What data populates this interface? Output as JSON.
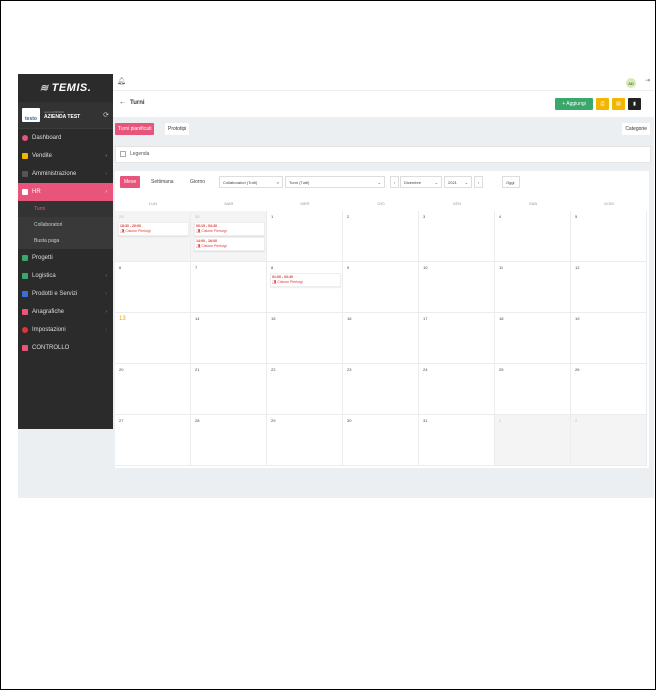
{
  "app": {
    "logo": "TEMIS.",
    "company_small": "testo AZIENDA",
    "company_name": "AZIENDA TEST",
    "company_logo": "testo"
  },
  "sidebar": {
    "items": [
      {
        "label": "Dashboard",
        "color": "#e8547a"
      },
      {
        "label": "Vendite",
        "color": "#f2b600"
      },
      {
        "label": "Amministrazione",
        "color": "#555555"
      },
      {
        "label": "HR",
        "color": "#e8547a"
      },
      {
        "label": "Progetti",
        "color": "#3aa76d"
      },
      {
        "label": "Logistica",
        "color": "#3aa76d"
      },
      {
        "label": "Prodotti e Servizi",
        "color": "#3b6fd8"
      },
      {
        "label": "Anagrafiche",
        "color": "#e8547a"
      },
      {
        "label": "Impostazioni",
        "color": "#e03535"
      },
      {
        "label": "CONTROLLO",
        "color": "#e8547a"
      }
    ],
    "hr_sub": [
      "Turni",
      "Collaboratori",
      "Busta paga"
    ]
  },
  "topbar": {
    "avatar": "AD"
  },
  "header": {
    "back": "←",
    "title": "Turni",
    "add_label": "+ Aggiungi",
    "add_color": "#3aa76d",
    "icon_btn_color": "#f2b600",
    "delete_color": "#222222"
  },
  "tabs": {
    "turni": "Turni pianificati",
    "prototipi": "Prototipi",
    "categorie": "Categorie",
    "active_color": "#e8547a"
  },
  "legend": {
    "label": "Legenda"
  },
  "filters": {
    "views": [
      "Mese",
      "Settimana",
      "Giorno"
    ],
    "collaboratori": "Collaboratori (Tutti)",
    "turni": "Turni (Tutti)",
    "month": "Dicembre",
    "year": "2021",
    "oggi": "Oggi"
  },
  "calendar": {
    "days_of_week": [
      "LUN",
      "MAR",
      "MER",
      "GIO",
      "VEN",
      "SAB",
      "DOM"
    ],
    "weeks": [
      [
        "29",
        "30",
        "1",
        "2",
        "3",
        "4",
        "5"
      ],
      [
        "6",
        "7",
        "8",
        "9",
        "10",
        "11",
        "12"
      ],
      [
        "13",
        "14",
        "15",
        "16",
        "17",
        "18",
        "19"
      ],
      [
        "20",
        "21",
        "22",
        "23",
        "24",
        "25",
        "26"
      ],
      [
        "27",
        "28",
        "29",
        "30",
        "31",
        "1",
        "2"
      ]
    ],
    "today": "13",
    "events": [
      {
        "time": "18:30 - 20:00",
        "person": "Cislone Pierluigi"
      },
      {
        "time": "00:15 - 03:30",
        "person": "Cislone Pierluigi"
      },
      {
        "time": "14:00 - 16:00",
        "person": "Cislone Pierluigi"
      },
      {
        "time": "01:00 - 03:30",
        "person": "Cislone Pierluigi"
      }
    ]
  }
}
